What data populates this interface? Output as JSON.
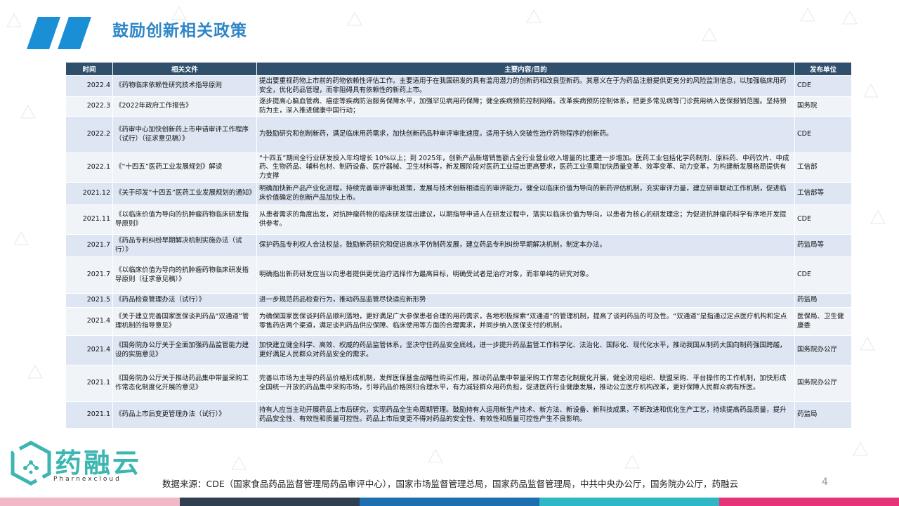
{
  "page": {
    "title": "鼓励创新相关政策",
    "page_number": "4",
    "source": "数据来源：CDE（国家食品药品监督管理局药品审评中心），国家市场监督管理总局，国家药品监督管理局，中共中央办公厅，国务院办公厅，药融云"
  },
  "logo": {
    "name": "药融云",
    "subtitle": "Pharnexcloud"
  },
  "colors": {
    "title": "#2e86c8",
    "header_bg": "#2f4f6d",
    "row_bg": "#dde6f2",
    "row_alt_bg": "#f0f4f9",
    "footer_segments": [
      "#f2b8c8",
      "#2f3f4f",
      "#1e6fb0",
      "#2fb7c6",
      "#e6347a"
    ]
  },
  "table": {
    "headers": [
      "时间",
      "相关文件",
      "主要内容/目的",
      "发布单位"
    ],
    "rows": [
      {
        "time": "2022.4",
        "document": "《药物临床依赖性研究技术指导原则",
        "content": "提出要重视药物上市前的药物依赖性评估工作。主要适用于在我国研发的具有滥用潜力的创新药和改良型新药。其意义在于为药品注册提供更充分的风险监测信息，以加强临床用药安全，优化药品管理，而非阻碍具有依赖性的新药上市。",
        "unit": "CDE"
      },
      {
        "time": "2022.3",
        "document": "《2022年政府工作报告》",
        "content": "逐步提高心脑血管病、癌症等疾病防治服务保障水平，加强罕见病用药保障；健全疾病预防控制网络。改革疾病预防控制体系，把更多常见病等门诊费用纳入医保报销范围。坚持预防为主，深入推进健康中国行动；",
        "unit": "国务院"
      },
      {
        "time": "2022.2",
        "document": "《药审中心加快创新药上市申请审评工作程序（试行）（征求意见稿）》",
        "content": "为鼓励研究和创制新药，满足临床用药需求，加快创新药品种审评审批速度。适用于纳入突破性治疗药物程序的创新药。",
        "unit": "CDE"
      },
      {
        "time": "2022.1",
        "document": "《“十四五”医药工业发展规划》解读",
        "content": "“十四五”期间全行业研发投入年均增长 10%以上；到 2025年，创新产品新增销售额占全行业营业收入增量的比重进一步增加。医药工业包括化学药制剂、原料药、中药饮片、中成药、生物药品、辅料包材、制药设备、医疗器械、卫生材料等，新发展阶段对医药工业提出更高要求，医药工业亟需加快质量变革、效率变革、动力变革，为构建新发展格局提供有力支撑",
        "unit": "工信部"
      },
      {
        "time": "2021.12",
        "document": "《关于印发“十四五”医药工业发展规划的通知》",
        "content": "明确加快新产品产业化进程，持续完善审评审批政策，发展与技术创新相适应的审评能力，健全以临床价值为导向的新药评估机制，充实审评力量，建立研审联动工作机制，促进临床价值确定的创新产品加快上市。",
        "unit": "工信部等"
      },
      {
        "time": "2021.11",
        "document": "《以临床价值为导向的抗肿瘤药物临床研发指导原则》",
        "content": "从患者需求的角度出发，对抗肿瘤药物的临床研发提出建议，以期指导申请人在研发过程中，落实以临床价值为导向，以患者为核心的研发理念；为促进抗肿瘤药科学有序地开发提供参考。",
        "unit": "CDE"
      },
      {
        "time": "2021.7",
        "document": "《药品专利纠纷早期解决机制实施办法（试行）》",
        "content": "保护药品专利权人合法权益，鼓励新药研究和促进高水平仿制药发展，建立药品专利纠纷早期解决机制，制定本办法。",
        "unit": "药监局等"
      },
      {
        "time": "2021.7",
        "document": "《以临床价值为导向的抗肿瘤药物临床研发指导原则（征求意见稿）》",
        "content": "明确指出新药研发应当以向患者提供更优治疗选择作为最高目标，明确受试者是治疗对象，而非单纯的研究对象。",
        "unit": "CDE"
      },
      {
        "time": "2021.5",
        "document": "《药品检查管理办法（试行）》",
        "content": "进一步规范药品检查行为，推动药品监管尽快适应新形势",
        "unit": "药监局"
      },
      {
        "time": "2021.4",
        "document": "《关于建立完善国家医保谈判药品“双通道”管理机制的指导意见》",
        "content": "为确保国家医保谈判药品顺利落地，更好满足广大参保患者合理的用药需求，各地积极探索“双通道”的管理机制，提高了谈判药品的可及性。“双通道”是指通过定点医疗机构和定点零售药店两个渠道，满足谈判药品供应保障、临床使用等方面的合理需求，并同步纳入医保支付的机制。",
        "unit": "医保局、卫生健康委"
      },
      {
        "time": "2021.4",
        "document": "《国务院办公厅关于全面加强药品监管能力建设的实施意见》",
        "content": "加快建立健全科学、高效、权威的药品监管体系，坚决守住药品安全底线，进一步提升药品监管工作科学化、法治化、国际化、现代化水平，推动我国从制药大国向制药强国跨越，更好满足人民群众对药品安全的需求。",
        "unit": "国务院办公厅"
      },
      {
        "time": "2021.1",
        "document": "《国务院办公厅关于推动药品集中带量采购工作常态化制度化开展的意见》",
        "content": "完善以市场为主导的药品价格形成机制，发挥医保基金战略性购买作用，推动药品集中带量采购工作常态化制度化开展，健全政府组织、联盟采购、平台操作的工作机制，加快形成全国统一开放的药品集中采购市场，引导药品价格回归合理水平，有力减轻群众用药负担，促进医药行业健康发展，推动公立医疗机构改革，更好保障人民群众病有所医。",
        "unit": "国务院办公厅"
      },
      {
        "time": "2021.1",
        "document": "《药品上市后变更管理办法（试行）》",
        "content": "持有人应当主动开展药品上市后研究，实现药品全生命周期管理。鼓励持有人运用新生产技术、新方法、新设备、新科技成果，不断改进和优化生产工艺，持续提高药品质量，提升药品安全性、有效性和质量可控性。药品上市后变更不得对药品的安全性、有效性和质量可控性产生不良影响。",
        "unit": "药监局"
      }
    ]
  }
}
